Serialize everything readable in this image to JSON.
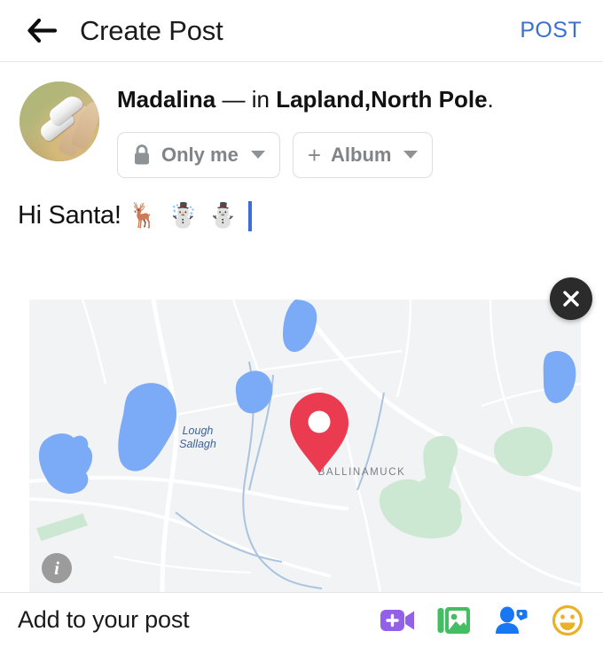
{
  "header": {
    "back_icon": "arrow-left-icon",
    "title": "Create Post",
    "post_label": "POST",
    "post_color": "#3b6fd4"
  },
  "author": {
    "avatar_alt": "user-avatar",
    "name": "Madalina",
    "separator": "—",
    "preposition": "in",
    "place": "Lapland,North Pole",
    "period": ".",
    "privacy_chip": {
      "icon": "lock-icon",
      "label": "Only me",
      "caret": "chevron-down-icon"
    },
    "album_chip": {
      "icon": "plus-icon",
      "label": "Album",
      "caret": "chevron-down-icon"
    }
  },
  "composer": {
    "text": "Hi Santa!",
    "emoji": "🦌 ☃️ ⛄",
    "cursor_visible": true
  },
  "map": {
    "close_icon": "close-icon",
    "info_icon": "info-icon",
    "pin_icon": "location-pin-icon",
    "pin_color": "#EA3B50",
    "water_color": "#7BAAF7",
    "land_color": "#F1F3F4",
    "park_color": "#CDE8D2",
    "road_color": "#FFFFFF",
    "labels": [
      {
        "name": "lake-label",
        "text": "Lough\nSallagh",
        "line1": "Lough",
        "line2": "Sallagh",
        "color": "#4a6fa5"
      },
      {
        "name": "town-label",
        "text": "BALLINAMUCK",
        "color": "#7a7f85"
      }
    ]
  },
  "footer": {
    "label": "Add to your post",
    "actions": [
      {
        "name": "live-video-button",
        "icon": "video-plus-icon",
        "color": "#9360e8"
      },
      {
        "name": "photo-video-button",
        "icon": "photo-stack-icon",
        "color": "#45bd62"
      },
      {
        "name": "tag-people-button",
        "icon": "person-tag-icon",
        "color": "#1877f2"
      },
      {
        "name": "feeling-activity-button",
        "icon": "smiley-icon",
        "color": "#eab026"
      }
    ]
  }
}
